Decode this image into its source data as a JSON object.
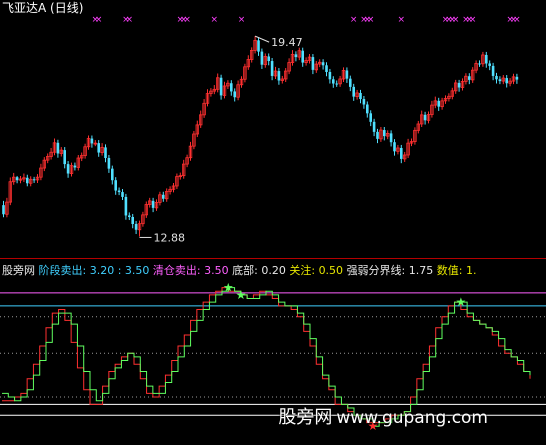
{
  "app": {
    "stock_title": "飞亚达A (日线)",
    "watermark_cn": "股旁网",
    "watermark_url": "www.gupang.com"
  },
  "indicator": {
    "name": "股旁网",
    "sell_label": "阶段卖出:",
    "sell_values": "3.20 : 3.50",
    "clear_label": "清仓卖出:",
    "clear_value": "3.50",
    "bottom_label": "底部:",
    "bottom_value": "0.20",
    "watch_label": "关注:",
    "watch_value": "0.50",
    "strength_label": "强弱分界线:",
    "strength_value": "1.75",
    "number_label": "数值:",
    "number_value": "1."
  },
  "chart_data": [
    {
      "type": "candlestick",
      "title": "飞亚达A (日线)",
      "annotations": [
        {
          "text": "19.47",
          "marks": "high"
        },
        {
          "text": "12.88",
          "marks": "low"
        }
      ],
      "ylim": [
        12.5,
        20.0
      ],
      "bull_color": "#ff3030",
      "bear_color": "#50e0ff",
      "signal_marker": "×",
      "signal_color": "#ff40ff",
      "signals": [
        27,
        28,
        36,
        37,
        52,
        53,
        54,
        62,
        70,
        103,
        106,
        107,
        108,
        117,
        130,
        131,
        132,
        133,
        136,
        137,
        138,
        149,
        150,
        151
      ],
      "candles": [
        [
          13.91,
          13.61,
          14.05,
          13.51
        ],
        [
          13.61,
          14.01,
          14.15,
          13.51
        ],
        [
          14.01,
          14.68,
          14.82,
          13.91
        ],
        [
          14.68,
          14.83,
          14.97,
          14.58
        ],
        [
          14.83,
          14.73,
          14.87,
          14.63
        ],
        [
          14.73,
          14.77,
          14.87,
          14.63
        ],
        [
          14.77,
          14.81,
          14.95,
          14.67
        ],
        [
          14.81,
          14.63,
          14.91,
          14.53
        ],
        [
          14.63,
          14.76,
          14.86,
          14.53
        ],
        [
          14.76,
          14.74,
          14.84,
          14.64
        ],
        [
          14.74,
          14.83,
          14.93,
          14.64
        ],
        [
          14.83,
          15.13,
          15.27,
          14.73
        ],
        [
          15.13,
          15.39,
          15.49,
          15.03
        ],
        [
          15.39,
          15.51,
          15.61,
          15.29
        ],
        [
          15.51,
          15.65,
          15.79,
          15.41
        ],
        [
          15.65,
          15.96,
          16.1,
          15.55
        ],
        [
          15.96,
          15.61,
          16.06,
          15.47
        ],
        [
          15.61,
          15.72,
          15.82,
          15.51
        ],
        [
          15.72,
          15.26,
          15.82,
          15.12
        ],
        [
          15.26,
          14.95,
          15.36,
          14.81
        ],
        [
          14.95,
          15.21,
          15.31,
          14.85
        ],
        [
          15.21,
          15.15,
          15.31,
          15.05
        ],
        [
          15.15,
          15.46,
          15.56,
          15.05
        ],
        [
          15.46,
          15.54,
          15.64,
          15.36
        ],
        [
          15.54,
          15.83,
          15.93,
          15.44
        ],
        [
          15.83,
          16.1,
          16.2,
          15.73
        ],
        [
          16.1,
          15.94,
          16.2,
          15.8
        ],
        [
          15.94,
          15.95,
          16.05,
          15.85
        ],
        [
          15.95,
          15.64,
          16.05,
          15.5
        ],
        [
          15.64,
          15.81,
          15.95,
          15.54
        ],
        [
          15.81,
          15.46,
          15.91,
          15.32
        ],
        [
          15.46,
          15.11,
          15.56,
          14.97
        ],
        [
          15.11,
          14.73,
          15.21,
          14.59
        ],
        [
          14.73,
          14.39,
          14.83,
          14.25
        ],
        [
          14.39,
          14.34,
          14.49,
          14.24
        ],
        [
          14.34,
          14.18,
          14.44,
          14.08
        ],
        [
          14.18,
          13.57,
          14.28,
          13.43
        ],
        [
          13.57,
          13.52,
          13.67,
          13.42
        ],
        [
          13.52,
          13.29,
          13.62,
          13.15
        ],
        [
          13.29,
          13.1,
          13.39,
          12.96
        ],
        [
          13.1,
          13.3,
          13.4,
          12.88
        ],
        [
          13.3,
          13.59,
          13.69,
          13.2
        ],
        [
          13.59,
          13.93,
          14.03,
          13.49
        ],
        [
          13.93,
          14.05,
          14.15,
          13.83
        ],
        [
          14.05,
          13.82,
          14.15,
          13.68
        ],
        [
          13.82,
          14.0,
          14.1,
          13.72
        ],
        [
          14.0,
          14.25,
          14.35,
          13.9
        ],
        [
          14.25,
          14.12,
          14.35,
          14.02
        ],
        [
          14.12,
          14.36,
          14.46,
          14.02
        ],
        [
          14.36,
          14.43,
          14.53,
          14.26
        ],
        [
          14.43,
          14.54,
          14.64,
          14.33
        ],
        [
          14.54,
          14.85,
          14.95,
          14.44
        ],
        [
          14.85,
          14.88,
          14.98,
          14.75
        ],
        [
          14.88,
          15.26,
          15.4,
          14.78
        ],
        [
          15.26,
          15.47,
          15.57,
          15.16
        ],
        [
          15.47,
          15.85,
          15.99,
          15.37
        ],
        [
          15.85,
          16.25,
          16.35,
          15.75
        ],
        [
          16.25,
          16.55,
          16.69,
          16.15
        ],
        [
          16.55,
          16.88,
          17.02,
          16.45
        ],
        [
          16.88,
          17.26,
          17.4,
          16.78
        ],
        [
          17.26,
          17.58,
          17.72,
          17.16
        ],
        [
          17.58,
          17.66,
          17.76,
          17.48
        ],
        [
          17.66,
          17.72,
          17.86,
          17.56
        ],
        [
          17.72,
          18.1,
          18.24,
          17.62
        ],
        [
          18.1,
          17.52,
          18.2,
          17.38
        ],
        [
          17.52,
          17.83,
          17.97,
          17.42
        ],
        [
          17.83,
          17.92,
          18.02,
          17.73
        ],
        [
          17.92,
          17.65,
          18.02,
          17.51
        ],
        [
          17.65,
          17.46,
          17.75,
          17.32
        ],
        [
          17.46,
          17.87,
          18.01,
          17.36
        ],
        [
          17.87,
          18.05,
          18.15,
          17.77
        ],
        [
          18.05,
          18.46,
          18.56,
          17.95
        ],
        [
          18.46,
          18.7,
          18.84,
          18.36
        ],
        [
          18.7,
          19.0,
          19.1,
          18.6
        ],
        [
          19.0,
          19.33,
          19.47,
          18.9
        ],
        [
          19.33,
          18.96,
          19.43,
          18.82
        ],
        [
          18.96,
          18.53,
          19.06,
          18.39
        ],
        [
          18.53,
          18.8,
          18.9,
          18.43
        ],
        [
          18.8,
          18.65,
          18.9,
          18.51
        ],
        [
          18.65,
          18.16,
          18.75,
          18.02
        ],
        [
          18.16,
          18.32,
          18.46,
          18.06
        ],
        [
          18.32,
          18.01,
          18.42,
          17.87
        ],
        [
          18.01,
          18.06,
          18.16,
          17.91
        ],
        [
          18.06,
          18.32,
          18.42,
          17.96
        ],
        [
          18.32,
          18.6,
          18.74,
          18.22
        ],
        [
          18.6,
          18.87,
          19.01,
          18.5
        ],
        [
          18.87,
          18.78,
          18.97,
          18.64
        ],
        [
          18.78,
          18.99,
          19.09,
          18.68
        ],
        [
          18.99,
          18.6,
          19.09,
          18.46
        ],
        [
          18.6,
          18.67,
          18.77,
          18.5
        ],
        [
          18.67,
          18.78,
          18.88,
          18.57
        ],
        [
          18.78,
          18.36,
          18.88,
          18.22
        ],
        [
          18.36,
          18.55,
          18.65,
          18.26
        ],
        [
          18.55,
          18.61,
          18.71,
          18.45
        ],
        [
          18.61,
          18.51,
          18.71,
          18.37
        ],
        [
          18.51,
          18.29,
          18.61,
          18.15
        ],
        [
          18.29,
          18.05,
          18.39,
          17.91
        ],
        [
          18.05,
          17.91,
          18.15,
          17.77
        ],
        [
          17.91,
          17.9,
          18.01,
          17.8
        ],
        [
          17.9,
          18.06,
          18.16,
          17.8
        ],
        [
          18.06,
          18.34,
          18.44,
          17.96
        ],
        [
          18.34,
          18.07,
          18.44,
          17.93
        ],
        [
          18.07,
          17.8,
          18.17,
          17.66
        ],
        [
          17.8,
          17.48,
          17.9,
          17.34
        ],
        [
          17.48,
          17.6,
          17.7,
          17.38
        ],
        [
          17.6,
          17.4,
          17.7,
          17.26
        ],
        [
          17.4,
          17.22,
          17.5,
          17.08
        ],
        [
          17.22,
          16.93,
          17.32,
          16.79
        ],
        [
          16.93,
          16.65,
          17.03,
          16.51
        ],
        [
          16.65,
          16.32,
          16.75,
          16.18
        ],
        [
          16.32,
          16.09,
          16.42,
          15.95
        ],
        [
          16.09,
          16.38,
          16.48,
          15.99
        ],
        [
          16.38,
          16.18,
          16.48,
          16.04
        ],
        [
          16.18,
          16.27,
          16.37,
          16.08
        ],
        [
          16.27,
          15.98,
          16.37,
          15.84
        ],
        [
          15.98,
          15.68,
          16.08,
          15.54
        ],
        [
          15.68,
          15.79,
          15.89,
          15.58
        ],
        [
          15.79,
          15.43,
          15.89,
          15.29
        ],
        [
          15.43,
          15.56,
          15.66,
          15.33
        ],
        [
          15.56,
          15.95,
          16.09,
          15.46
        ],
        [
          15.95,
          16.0,
          16.1,
          15.85
        ],
        [
          16.0,
          16.37,
          16.47,
          15.9
        ],
        [
          16.37,
          16.58,
          16.68,
          16.27
        ],
        [
          16.58,
          16.88,
          17.02,
          16.48
        ],
        [
          16.88,
          16.7,
          16.98,
          16.56
        ],
        [
          16.7,
          16.89,
          16.99,
          16.6
        ],
        [
          16.89,
          17.2,
          17.34,
          16.79
        ],
        [
          17.2,
          17.34,
          17.48,
          17.1
        ],
        [
          17.34,
          17.15,
          17.44,
          17.01
        ],
        [
          17.15,
          17.34,
          17.44,
          17.05
        ],
        [
          17.34,
          17.42,
          17.52,
          17.24
        ],
        [
          17.42,
          17.49,
          17.59,
          17.32
        ],
        [
          17.49,
          17.67,
          17.77,
          17.39
        ],
        [
          17.67,
          17.93,
          18.03,
          17.57
        ],
        [
          17.93,
          17.78,
          18.03,
          17.64
        ],
        [
          17.78,
          17.98,
          18.08,
          17.68
        ],
        [
          17.98,
          18.15,
          18.25,
          17.88
        ],
        [
          18.15,
          18.03,
          18.25,
          17.89
        ],
        [
          18.03,
          18.35,
          18.45,
          17.93
        ],
        [
          18.35,
          18.57,
          18.67,
          18.25
        ],
        [
          18.57,
          18.56,
          18.67,
          18.46
        ],
        [
          18.56,
          18.85,
          18.95,
          18.46
        ],
        [
          18.85,
          18.57,
          18.95,
          18.43
        ],
        [
          18.57,
          18.49,
          18.67,
          18.35
        ],
        [
          18.49,
          18.16,
          18.59,
          18.02
        ],
        [
          18.16,
          18.05,
          18.26,
          17.91
        ],
        [
          18.05,
          17.99,
          18.15,
          17.89
        ],
        [
          17.99,
          18.09,
          18.19,
          17.89
        ],
        [
          18.09,
          17.92,
          18.19,
          17.78
        ],
        [
          17.92,
          17.99,
          18.09,
          17.82
        ],
        [
          17.99,
          18.13,
          18.23,
          17.89
        ],
        [
          18.13,
          18.04,
          18.23,
          17.9
        ]
      ]
    },
    {
      "type": "line",
      "title": "股旁网",
      "ylim": [
        -0.45,
        4.1
      ],
      "hlines": [
        {
          "name": "阶段卖出",
          "value": 3.2,
          "color": "#40d0ff"
        },
        {
          "name": "阶段卖出",
          "value": 3.5,
          "color": "#40d0ff"
        },
        {
          "name": "清仓卖出",
          "value": 3.5,
          "color": "#ff60ff"
        },
        {
          "name": "底部",
          "value": 0.2,
          "color": "#ffffff"
        },
        {
          "name": "关注",
          "value": 0.5,
          "color": "#ffffff"
        },
        {
          "name": "强弱分界线",
          "value": 1.75,
          "color": "#ffffff"
        }
      ],
      "ref_dashed": [
        0.7,
        1.9,
        2.9
      ],
      "series": [
        {
          "name": "数值",
          "color": "#ff3030",
          "values": [
            0.6,
            0.6,
            0.7,
            0.8,
            1.2,
            1.6,
            2.1,
            2.6,
            3.0,
            3.1,
            2.8,
            2.2,
            1.5,
            0.9,
            0.5,
            0.5,
            1.0,
            1.4,
            1.6,
            1.8,
            1.9,
            1.6,
            1.2,
            0.8,
            0.7,
            1.0,
            1.3,
            1.7,
            2.1,
            2.4,
            2.8,
            3.1,
            3.3,
            3.5,
            3.6,
            3.7,
            3.6,
            3.6,
            3.5,
            3.4,
            3.5,
            3.6,
            3.5,
            3.4,
            3.2,
            3.2,
            3.1,
            2.9,
            2.5,
            2.1,
            1.6,
            1.2,
            0.9,
            0.5,
            0.5,
            0.3,
            0.2,
            0.1,
            0.0,
            0.0,
            0.0,
            0.1,
            0.2,
            0.2,
            0.3,
            0.7,
            1.2,
            1.6,
            2.1,
            2.6,
            2.9,
            3.2,
            3.3,
            3.1,
            2.9,
            2.8,
            2.7,
            2.6,
            2.4,
            2.1,
            1.9,
            1.8,
            1.6,
            1.4,
            1.2
          ]
        },
        {
          "name": "信号",
          "color": "#60ff60",
          "values": [
            0.8,
            0.7,
            0.6,
            0.7,
            0.9,
            1.3,
            1.7,
            2.2,
            2.7,
            3.0,
            3.0,
            2.7,
            2.1,
            1.4,
            0.9,
            0.6,
            0.8,
            1.2,
            1.5,
            1.7,
            1.9,
            1.8,
            1.4,
            1.0,
            0.8,
            0.8,
            1.1,
            1.4,
            1.8,
            2.1,
            2.5,
            2.8,
            3.1,
            3.3,
            3.5,
            3.6,
            3.7,
            3.6,
            3.5,
            3.4,
            3.4,
            3.5,
            3.6,
            3.5,
            3.3,
            3.2,
            3.2,
            3.0,
            2.7,
            2.3,
            1.8,
            1.3,
            1.0,
            0.7,
            0.5,
            0.4,
            0.2,
            0.1,
            0.1,
            -0.1,
            0.0,
            0.0,
            0.1,
            0.2,
            0.3,
            0.5,
            0.9,
            1.4,
            1.8,
            2.3,
            2.7,
            3.0,
            3.3,
            3.3,
            3.0,
            2.8,
            2.7,
            2.6,
            2.5,
            2.3,
            2.0,
            1.8,
            1.7,
            1.4,
            1.3
          ]
        }
      ],
      "markers": [
        {
          "label": "清仓卖出",
          "at": 36,
          "color": "#60ff60"
        },
        {
          "label": "清仓卖出",
          "at": 38,
          "color": "#60ff60"
        },
        {
          "label": "底部",
          "at": 59,
          "color": "#ff3030"
        },
        {
          "label": "清仓卖出",
          "at": 73,
          "color": "#60ff60"
        }
      ]
    }
  ]
}
